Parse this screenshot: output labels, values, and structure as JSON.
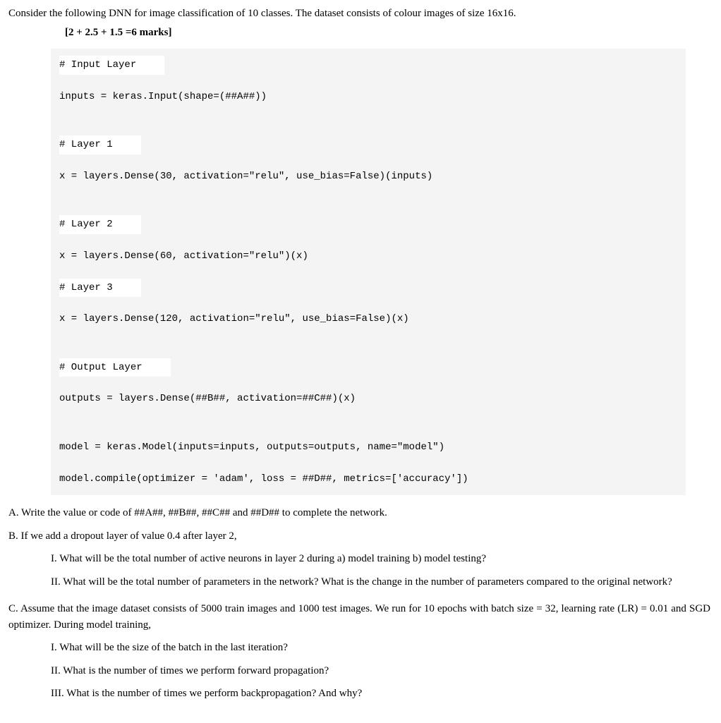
{
  "intro": "Consider the following DNN for image classification of 10 classes. The dataset consists of colour images of size 16x16.",
  "marks": "[2 + 2.5 + 1.5 =6 marks]",
  "code": {
    "c1": "# Input Layer",
    "c2": "inputs = keras.Input(shape=(##A##))",
    "c3": "# Layer 1",
    "c4": "x = layers.Dense(30, activation=\"relu\", use_bias=False)(inputs)",
    "c5": "# Layer 2",
    "c6": "x = layers.Dense(60, activation=\"relu\")(x)",
    "c7": "# Layer 3",
    "c8": "x = layers.Dense(120, activation=\"relu\", use_bias=False)(x)",
    "c9": "# Output Layer",
    "c10": "outputs = layers.Dense(##B##, activation=##C##)(x)",
    "c11": "model = keras.Model(inputs=inputs, outputs=outputs, name=\"model\")",
    "c12": "model.compile(optimizer = 'adam', loss = ##D##, metrics=['accuracy'])"
  },
  "qA": "A. Write the value or code of ##A##, ##B##, ##C## and ##D## to complete the network.",
  "qB": "B. If we add a dropout layer of value 0.4 after layer 2,",
  "qB_I": "I. What will be the total number of active neurons in layer 2 during a) model training b) model testing?",
  "qB_II": "II. What will be the total number of parameters in the network? What is the change in the number of parameters compared to the original network?",
  "qC": "C. Assume that the image dataset consists of 5000 train images and 1000 test images. We run for 10 epochs with batch size = 32, learning rate (LR) = 0.01 and SGD optimizer. During model training,",
  "qC_I": "I. What will be the size of the batch in the last iteration?",
  "qC_II": "II. What is the number of times we perform forward propagation?",
  "qC_III": "III. What is the number of times we perform backpropagation? And why?"
}
